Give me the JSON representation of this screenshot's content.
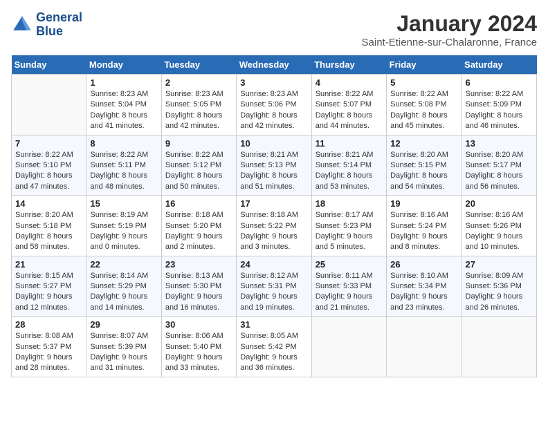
{
  "header": {
    "logo_line1": "General",
    "logo_line2": "Blue",
    "month": "January 2024",
    "location": "Saint-Etienne-sur-Chalaronne, France"
  },
  "weekdays": [
    "Sunday",
    "Monday",
    "Tuesday",
    "Wednesday",
    "Thursday",
    "Friday",
    "Saturday"
  ],
  "weeks": [
    [
      {
        "day": "",
        "sunrise": "",
        "sunset": "",
        "daylight": ""
      },
      {
        "day": "1",
        "sunrise": "8:23 AM",
        "sunset": "5:04 PM",
        "daylight": "8 hours and 41 minutes."
      },
      {
        "day": "2",
        "sunrise": "8:23 AM",
        "sunset": "5:05 PM",
        "daylight": "8 hours and 42 minutes."
      },
      {
        "day": "3",
        "sunrise": "8:23 AM",
        "sunset": "5:06 PM",
        "daylight": "8 hours and 42 minutes."
      },
      {
        "day": "4",
        "sunrise": "8:22 AM",
        "sunset": "5:07 PM",
        "daylight": "8 hours and 44 minutes."
      },
      {
        "day": "5",
        "sunrise": "8:22 AM",
        "sunset": "5:08 PM",
        "daylight": "8 hours and 45 minutes."
      },
      {
        "day": "6",
        "sunrise": "8:22 AM",
        "sunset": "5:09 PM",
        "daylight": "8 hours and 46 minutes."
      }
    ],
    [
      {
        "day": "7",
        "sunrise": "8:22 AM",
        "sunset": "5:10 PM",
        "daylight": "8 hours and 47 minutes."
      },
      {
        "day": "8",
        "sunrise": "8:22 AM",
        "sunset": "5:11 PM",
        "daylight": "8 hours and 48 minutes."
      },
      {
        "day": "9",
        "sunrise": "8:22 AM",
        "sunset": "5:12 PM",
        "daylight": "8 hours and 50 minutes."
      },
      {
        "day": "10",
        "sunrise": "8:21 AM",
        "sunset": "5:13 PM",
        "daylight": "8 hours and 51 minutes."
      },
      {
        "day": "11",
        "sunrise": "8:21 AM",
        "sunset": "5:14 PM",
        "daylight": "8 hours and 53 minutes."
      },
      {
        "day": "12",
        "sunrise": "8:20 AM",
        "sunset": "5:15 PM",
        "daylight": "8 hours and 54 minutes."
      },
      {
        "day": "13",
        "sunrise": "8:20 AM",
        "sunset": "5:17 PM",
        "daylight": "8 hours and 56 minutes."
      }
    ],
    [
      {
        "day": "14",
        "sunrise": "8:20 AM",
        "sunset": "5:18 PM",
        "daylight": "8 hours and 58 minutes."
      },
      {
        "day": "15",
        "sunrise": "8:19 AM",
        "sunset": "5:19 PM",
        "daylight": "9 hours and 0 minutes."
      },
      {
        "day": "16",
        "sunrise": "8:18 AM",
        "sunset": "5:20 PM",
        "daylight": "9 hours and 2 minutes."
      },
      {
        "day": "17",
        "sunrise": "8:18 AM",
        "sunset": "5:22 PM",
        "daylight": "9 hours and 3 minutes."
      },
      {
        "day": "18",
        "sunrise": "8:17 AM",
        "sunset": "5:23 PM",
        "daylight": "9 hours and 5 minutes."
      },
      {
        "day": "19",
        "sunrise": "8:16 AM",
        "sunset": "5:24 PM",
        "daylight": "9 hours and 8 minutes."
      },
      {
        "day": "20",
        "sunrise": "8:16 AM",
        "sunset": "5:26 PM",
        "daylight": "9 hours and 10 minutes."
      }
    ],
    [
      {
        "day": "21",
        "sunrise": "8:15 AM",
        "sunset": "5:27 PM",
        "daylight": "9 hours and 12 minutes."
      },
      {
        "day": "22",
        "sunrise": "8:14 AM",
        "sunset": "5:29 PM",
        "daylight": "9 hours and 14 minutes."
      },
      {
        "day": "23",
        "sunrise": "8:13 AM",
        "sunset": "5:30 PM",
        "daylight": "9 hours and 16 minutes."
      },
      {
        "day": "24",
        "sunrise": "8:12 AM",
        "sunset": "5:31 PM",
        "daylight": "9 hours and 19 minutes."
      },
      {
        "day": "25",
        "sunrise": "8:11 AM",
        "sunset": "5:33 PM",
        "daylight": "9 hours and 21 minutes."
      },
      {
        "day": "26",
        "sunrise": "8:10 AM",
        "sunset": "5:34 PM",
        "daylight": "9 hours and 23 minutes."
      },
      {
        "day": "27",
        "sunrise": "8:09 AM",
        "sunset": "5:36 PM",
        "daylight": "9 hours and 26 minutes."
      }
    ],
    [
      {
        "day": "28",
        "sunrise": "8:08 AM",
        "sunset": "5:37 PM",
        "daylight": "9 hours and 28 minutes."
      },
      {
        "day": "29",
        "sunrise": "8:07 AM",
        "sunset": "5:39 PM",
        "daylight": "9 hours and 31 minutes."
      },
      {
        "day": "30",
        "sunrise": "8:06 AM",
        "sunset": "5:40 PM",
        "daylight": "9 hours and 33 minutes."
      },
      {
        "day": "31",
        "sunrise": "8:05 AM",
        "sunset": "5:42 PM",
        "daylight": "9 hours and 36 minutes."
      },
      {
        "day": "",
        "sunrise": "",
        "sunset": "",
        "daylight": ""
      },
      {
        "day": "",
        "sunrise": "",
        "sunset": "",
        "daylight": ""
      },
      {
        "day": "",
        "sunrise": "",
        "sunset": "",
        "daylight": ""
      }
    ]
  ]
}
